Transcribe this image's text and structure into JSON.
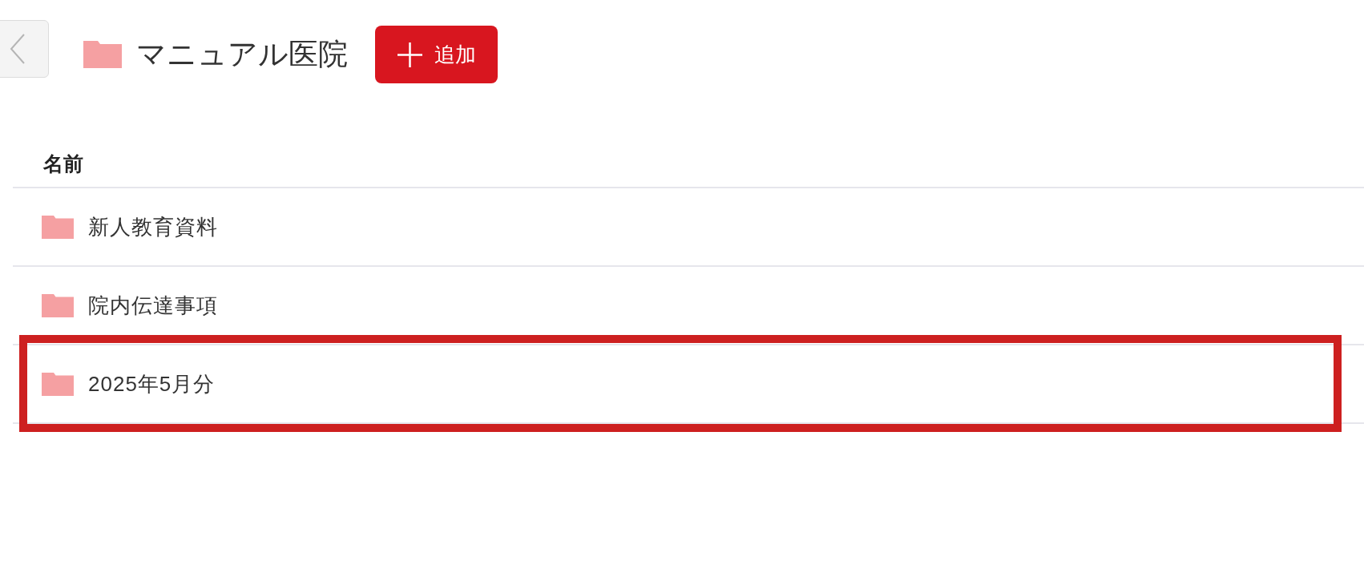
{
  "header": {
    "title": "マニュアル医院",
    "add_button": {
      "label": "追加"
    }
  },
  "table": {
    "columns": [
      "名前"
    ],
    "rows": [
      {
        "name": "新人教育資料",
        "highlighted": false
      },
      {
        "name": "院内伝達事項",
        "highlighted": false
      },
      {
        "name": "2025年5月分",
        "highlighted": true
      }
    ]
  }
}
